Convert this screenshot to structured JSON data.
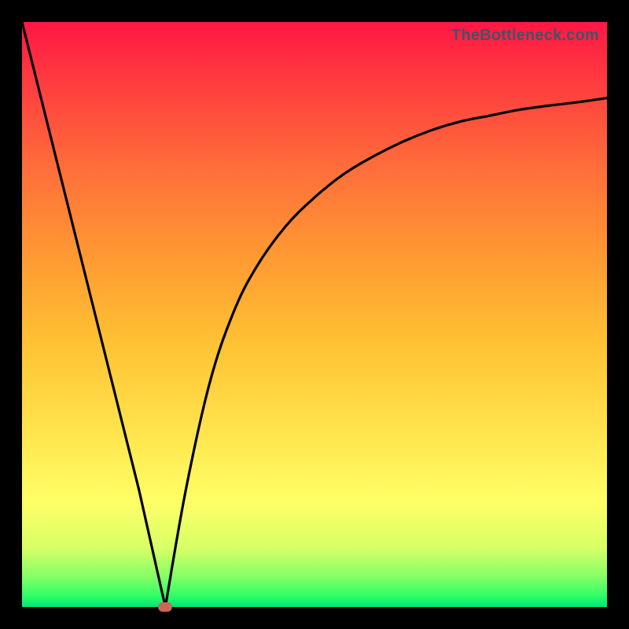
{
  "watermark": "TheBottleneck.com",
  "chart_data": {
    "type": "line",
    "title": "",
    "xlabel": "",
    "ylabel": "",
    "xlim": [
      0,
      100
    ],
    "ylim": [
      0,
      100
    ],
    "grid": false,
    "legend": false,
    "series": [
      {
        "name": "bottleneck-curve",
        "x": [
          0,
          5,
          10,
          15,
          20,
          24.5,
          28,
          32,
          36,
          40,
          45,
          50,
          55,
          60,
          65,
          70,
          75,
          80,
          85,
          90,
          95,
          100
        ],
        "values": [
          100,
          80,
          60,
          40,
          20,
          0,
          20,
          38,
          50,
          58,
          65,
          70,
          74,
          77,
          79.5,
          81.5,
          83,
          84,
          85,
          85.7,
          86.3,
          87
        ]
      }
    ],
    "marker": {
      "x": 24.5,
      "y": 0,
      "name": "optimal-point"
    },
    "background": {
      "type": "vertical-gradient",
      "stops": [
        {
          "pos": 0,
          "color": "#ff1744"
        },
        {
          "pos": 25,
          "color": "#ff6e3a"
        },
        {
          "pos": 55,
          "color": "#ffc233"
        },
        {
          "pos": 82,
          "color": "#ffff66"
        },
        {
          "pos": 100,
          "color": "#00e676"
        }
      ]
    }
  }
}
